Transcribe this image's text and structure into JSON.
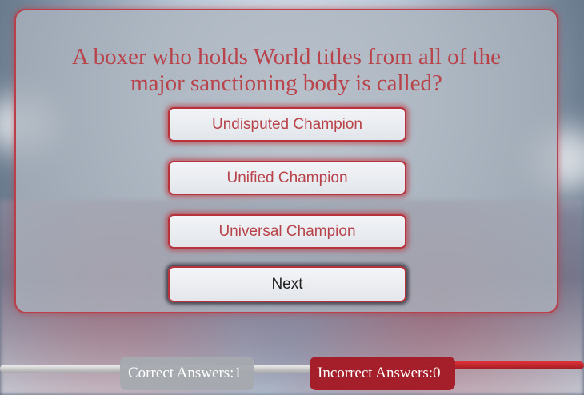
{
  "quiz": {
    "question": "A boxer who holds World titles from all of the major sanctioning body is called?",
    "answers": [
      "Undisputed Champion",
      "Unified Champion",
      "Universal Champion"
    ],
    "next_label": "Next"
  },
  "scores": {
    "correct_label": "Correct Answers:",
    "correct_value": "1",
    "incorrect_label": "Incorrect Answers:",
    "incorrect_value": "0"
  },
  "colors": {
    "accent_red": "#b8434a",
    "incorrect_badge": "#a51f2a",
    "correct_badge": "#a5aaaf"
  }
}
